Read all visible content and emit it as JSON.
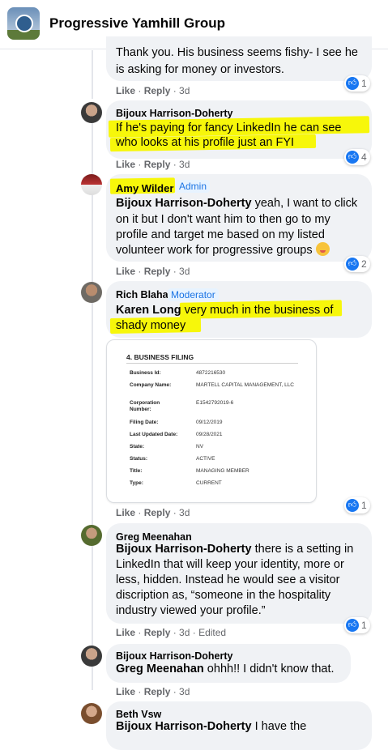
{
  "header": {
    "group_name": "Progressive Yamhill Group"
  },
  "meta": {
    "like": "Like",
    "reply": "Reply",
    "sep": " · "
  },
  "comments": [
    {
      "text": "Thank you. His business seems fishy- I see he",
      "text2": "is asking for money or investors.",
      "time": "3d",
      "reactions": "1"
    },
    {
      "author": "Bijoux Harrison-Doherty",
      "text": "If he's paying for fancy LinkedIn he can see",
      "text2": "who looks at his profile just an FYI",
      "time": "3d",
      "reactions": "4"
    },
    {
      "author": "Amy Wilder",
      "badge": "Admin",
      "mention": "Bijoux Harrison-Doherty",
      "text": " yeah, I want to click",
      "text2": "on it but I don't want him to then go to my",
      "text3": "profile and target me based on my listed",
      "text4": "volunteer work for progressive groups",
      "time": "3d",
      "reactions": "2"
    },
    {
      "author": "Rich Blaha",
      "badge": "Moderator",
      "mention": "Karen Long",
      "text": " very much in the business of",
      "text2": "shady money",
      "time": "3d",
      "reactions": "1"
    },
    {
      "author": "Greg Meenahan",
      "mention": "Bijoux Harrison-Doherty",
      "text": " there is a setting in",
      "text2": "LinkedIn that will keep your identity, more or",
      "text3": "less, hidden. Instead he would see a visitor",
      "text4": "discription as, “someone in the hospitality",
      "text5": "industry viewed your profile.”",
      "time": "3d",
      "edited": " · Edited",
      "reactions": "1"
    },
    {
      "author": "Bijoux Harrison-Doherty",
      "mention": "Greg Meenahan",
      "text": " ohhh!! I didn't know that.",
      "time": "3d"
    },
    {
      "author": "Beth Vsw",
      "mention": "Bijoux Harrison-Doherty",
      "text": " I have the"
    }
  ],
  "document": {
    "title": "4. BUSINESS FILING",
    "rows": [
      {
        "label": "Business Id:",
        "value": "4872216530"
      },
      {
        "label": "Company Name:",
        "value": "MARTELL CAPITAL MANAGEMENT, LLC"
      },
      {
        "label": "Corporation Number:",
        "value": "E1542792019-6"
      },
      {
        "label": "Filing Date:",
        "value": "09/12/2019"
      },
      {
        "label": "Last Updated Date:",
        "value": "09/28/2021"
      },
      {
        "label": "State:",
        "value": "NV"
      },
      {
        "label": "Status:",
        "value": "ACTIVE"
      },
      {
        "label": "Title:",
        "value": "MANAGING MEMBER"
      },
      {
        "label": "Type:",
        "value": "CURRENT"
      }
    ]
  },
  "colors": {
    "highlight": "#f7f70a",
    "bubble": "#f0f2f5",
    "link": "#1b74e4",
    "like_blue": "#1877f2"
  },
  "icons": {
    "like": "thumbs-up-icon",
    "laugh": "laughing-emoji-icon",
    "avatar": "profile-picture"
  }
}
